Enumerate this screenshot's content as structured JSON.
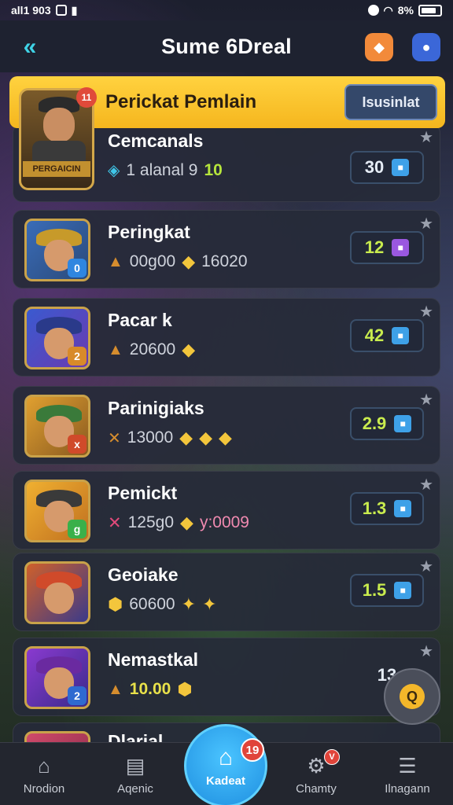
{
  "status_bar": {
    "left_text": "all1 903",
    "battery": "8%"
  },
  "header": {
    "title": "Sume 6Dreal",
    "back_icon": "back-icon"
  },
  "banner": {
    "title": "Perickat Pemlain",
    "button_label": "Isusinlat"
  },
  "top_player": {
    "plate": "PERGAICIN",
    "rank_badge": "11"
  },
  "players": [
    {
      "name": "Cemcanals",
      "stat1": "1 alanal 9",
      "stat2": "10",
      "score": "30"
    },
    {
      "name": "Peringkat",
      "stat1": "00g00",
      "stat2": "16020",
      "score": "12",
      "badge": "0"
    },
    {
      "name": "Pacar k",
      "stat1": "20600",
      "score": "42",
      "badge": "2"
    },
    {
      "name": "Parinigiaks",
      "stat1": "13000",
      "score": "2.9",
      "badge": "x"
    },
    {
      "name": "Pemickt",
      "stat1": "125g0",
      "stat2": "y:0009",
      "score": "1.3",
      "badge": "g"
    },
    {
      "name": "Geoiake",
      "stat1": "60600",
      "score": "1.5"
    },
    {
      "name": "Nemastkal",
      "stat1": "10.00",
      "score": "13",
      "badge": "2"
    },
    {
      "name": "Dlarial"
    }
  ],
  "fab_label": "Q",
  "bottom_nav": [
    {
      "label": "Nrodion"
    },
    {
      "label": "Aqenic"
    },
    {
      "label": "Kadeat",
      "badge": "19"
    },
    {
      "label": "Chamty",
      "badge": "V"
    },
    {
      "label": "Ilnagann"
    }
  ]
}
